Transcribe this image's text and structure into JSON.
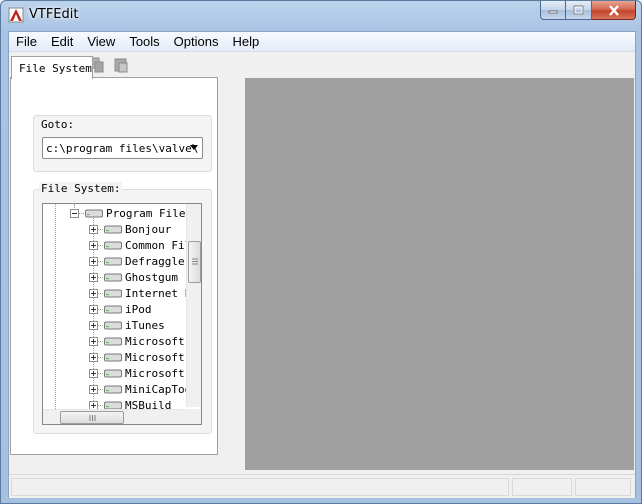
{
  "window": {
    "title": "VTFEdit"
  },
  "menu": {
    "items": [
      "File",
      "Edit",
      "View",
      "Tools",
      "Options",
      "Help"
    ]
  },
  "toolbar": {
    "icons": [
      "new-document-icon",
      "open-folder-icon",
      "save-icon",
      "copy-icon",
      "paste-icon"
    ]
  },
  "panel": {
    "tab_label": "File System",
    "goto_label": "Goto:",
    "goto_value": "c:\\program files\\valve\\",
    "filesystem_label": "File System:",
    "tree": {
      "root": "Program Files",
      "children": [
        "Bonjour",
        "Common Fil",
        "Defraggler",
        "Ghostgum",
        "Internet E",
        "iPod",
        "iTunes",
        "Microsoft",
        "Microsoft",
        "Microsoft",
        "MiniCapToo",
        "MSBuild"
      ]
    }
  },
  "colors": {
    "workspace": "#a0a0a0",
    "close_button": "#c3432a"
  }
}
